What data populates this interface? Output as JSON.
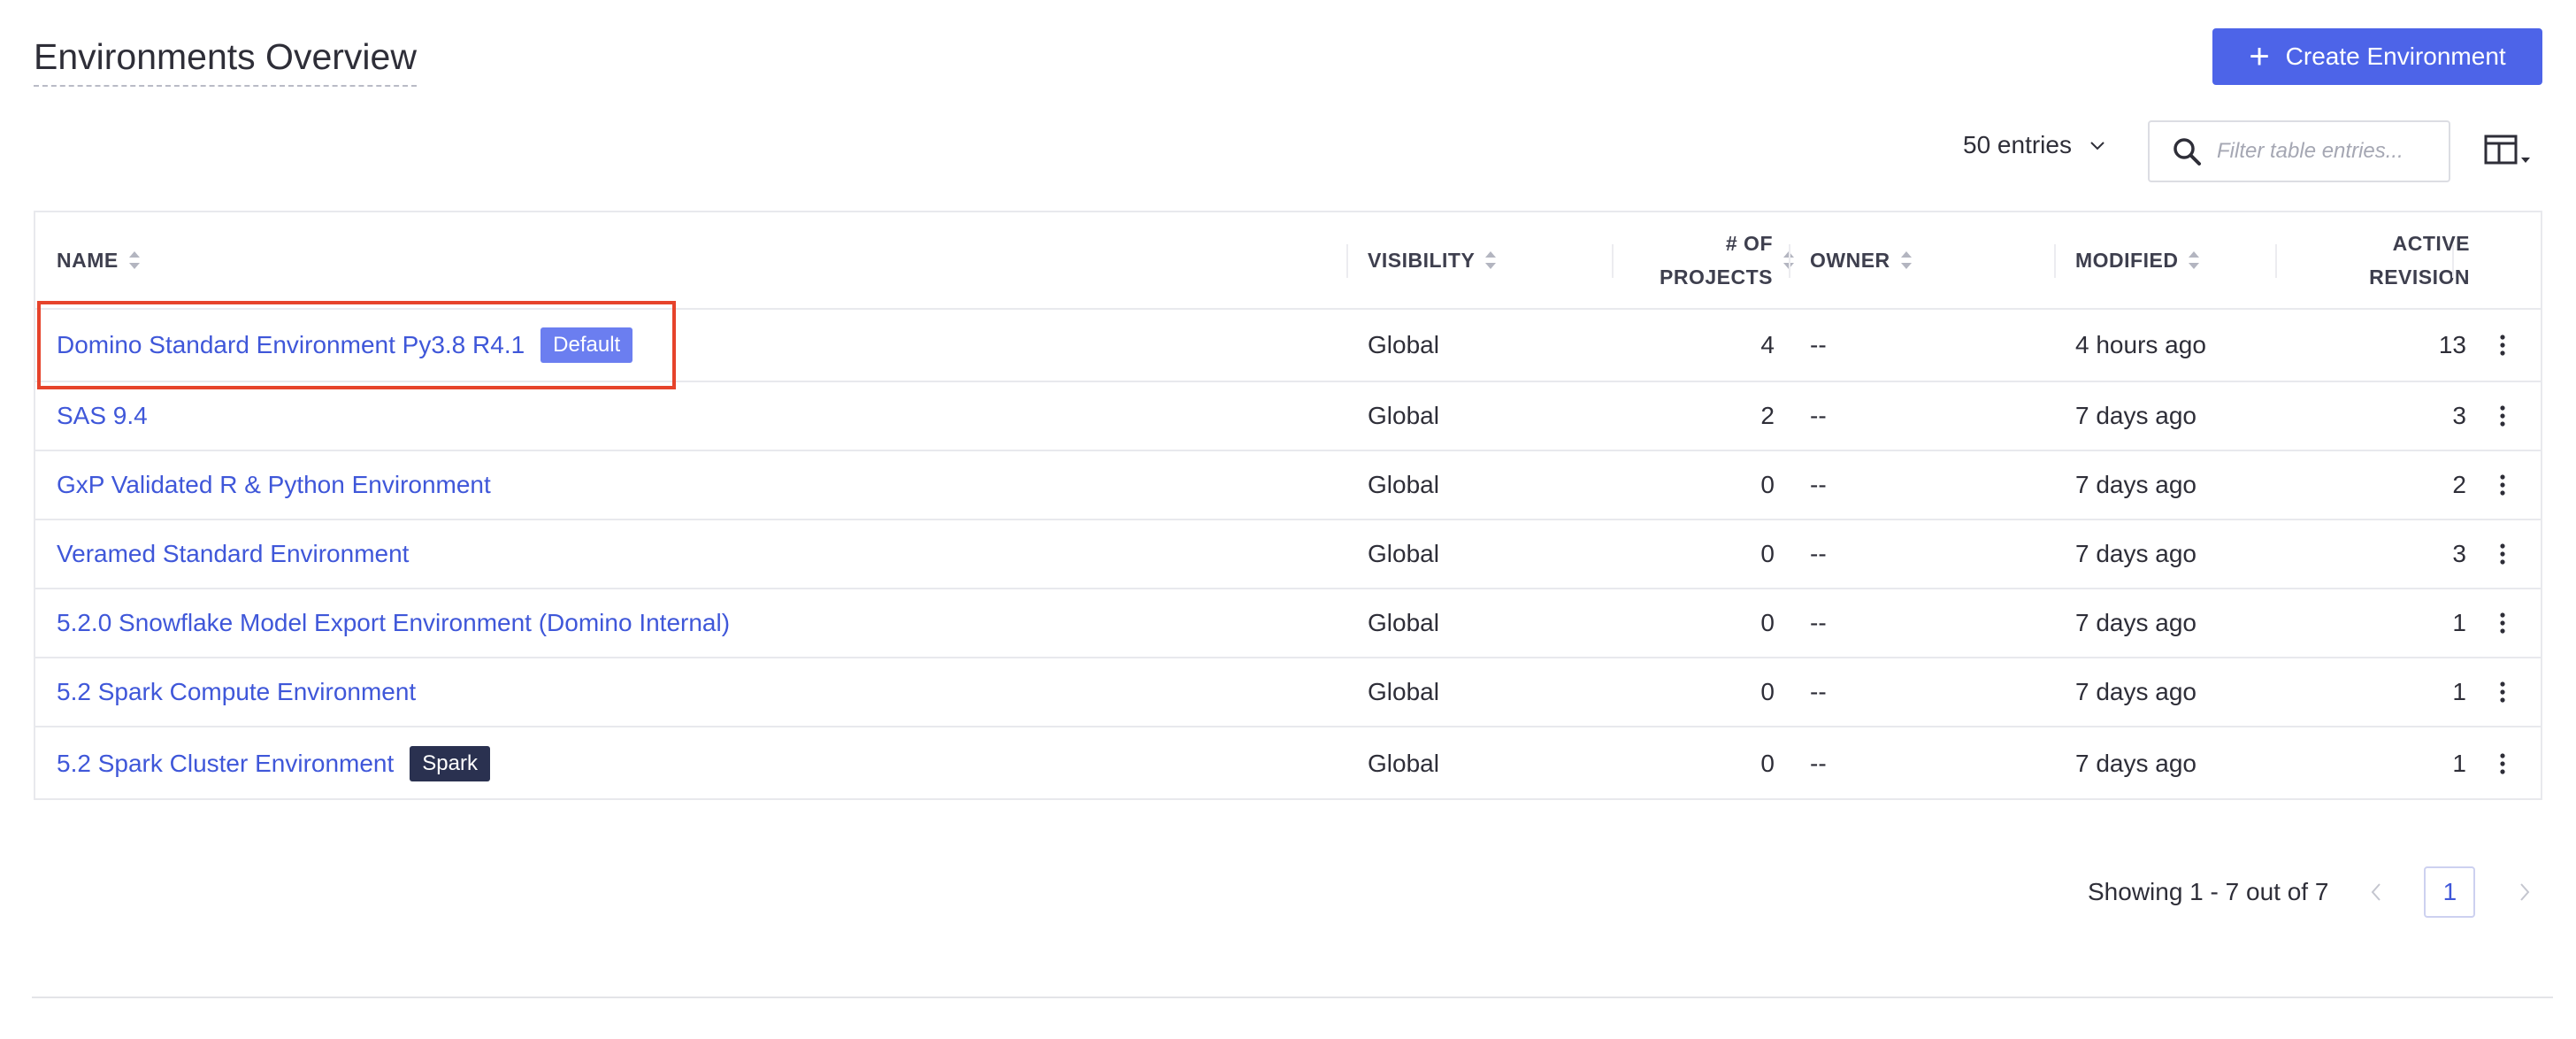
{
  "page": {
    "title": "Environments Overview",
    "create_button_label": "Create Environment"
  },
  "controls": {
    "entries_label": "50 entries",
    "filter_placeholder": "Filter table entries..."
  },
  "table": {
    "columns": {
      "name": "NAME",
      "visibility": "VISIBILITY",
      "projects_line1": "# OF",
      "projects_line2": "PROJECTS",
      "owner": "OWNER",
      "modified": "MODIFIED",
      "revision_line1": "ACTIVE",
      "revision_line2": "REVISION"
    },
    "rows": [
      {
        "name": "Domino Standard Environment Py3.8 R4.1",
        "badge": "Default",
        "visibility": "Global",
        "projects": "4",
        "owner": "--",
        "modified": "4 hours ago",
        "revision": "13"
      },
      {
        "name": "SAS 9.4",
        "badge": "",
        "visibility": "Global",
        "projects": "2",
        "owner": "--",
        "modified": "7 days ago",
        "revision": "3"
      },
      {
        "name": "GxP Validated R & Python Environment",
        "badge": "",
        "visibility": "Global",
        "projects": "0",
        "owner": "--",
        "modified": "7 days ago",
        "revision": "2"
      },
      {
        "name": "Veramed Standard Environment",
        "badge": "",
        "visibility": "Global",
        "projects": "0",
        "owner": "--",
        "modified": "7 days ago",
        "revision": "3"
      },
      {
        "name": "5.2.0 Snowflake Model Export Environment (Domino Internal)",
        "badge": "",
        "visibility": "Global",
        "projects": "0",
        "owner": "--",
        "modified": "7 days ago",
        "revision": "1"
      },
      {
        "name": "5.2 Spark Compute Environment",
        "badge": "",
        "visibility": "Global",
        "projects": "0",
        "owner": "--",
        "modified": "7 days ago",
        "revision": "1"
      },
      {
        "name": "5.2 Spark Cluster Environment",
        "badge": "Spark",
        "visibility": "Global",
        "projects": "0",
        "owner": "--",
        "modified": "7 days ago",
        "revision": "1"
      }
    ]
  },
  "pagination": {
    "showing": "Showing 1 - 7 out of 7",
    "current_page": "1"
  },
  "colors": {
    "accent": "#4d64e8",
    "link": "#3f57d9",
    "default_badge": "#6b7ef0",
    "spark_badge": "#2a3150",
    "highlight": "#e6432b"
  },
  "icons": {
    "create": "plus-icon",
    "entries": "chevron-down-icon",
    "filter": "search-icon",
    "columns": "column-layout-icon",
    "sort": "sort-icon",
    "row_menu": "kebab-menu-icon",
    "prev": "chevron-left-icon",
    "next": "chevron-right-icon"
  }
}
